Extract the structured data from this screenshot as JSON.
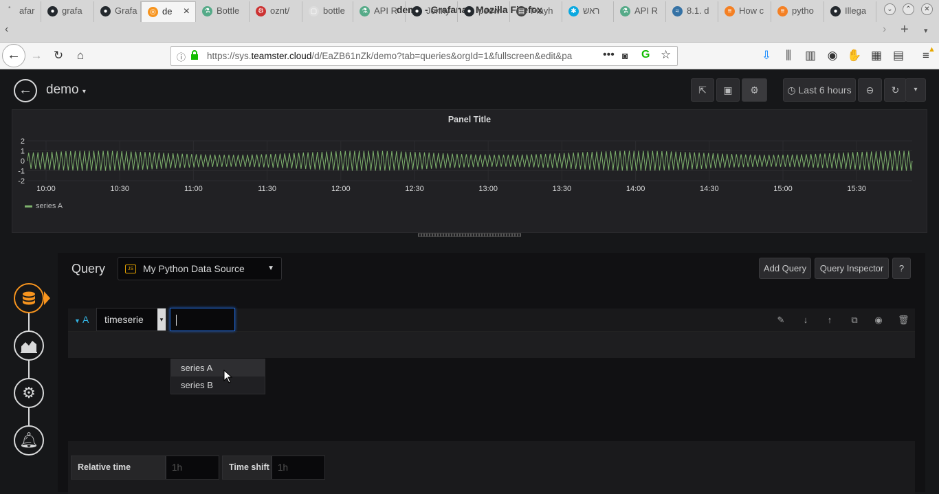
{
  "window": {
    "title": "demo - Grafana - Mozilla Firefox"
  },
  "tabs": [
    {
      "label": "afar",
      "icon": "grafana-icon"
    },
    {
      "label": "grafa",
      "icon": "github-icon"
    },
    {
      "label": "Grafa",
      "icon": "github-icon"
    },
    {
      "label": "de",
      "icon": "grafana-icon",
      "active": true
    },
    {
      "label": "Bottle",
      "icon": "flask-icon"
    },
    {
      "label": "oznt/",
      "icon": "gear-icon"
    },
    {
      "label": "bottle",
      "icon": "cube-icon"
    },
    {
      "label": "API R",
      "icon": "flask-icon"
    },
    {
      "label": "Jonny",
      "icon": "github-icon"
    },
    {
      "label": "peew",
      "icon": "github-icon"
    },
    {
      "label": "Playh",
      "icon": "book-icon"
    },
    {
      "label": "ראש",
      "icon": "hebrew-site-icon"
    },
    {
      "label": "API R",
      "icon": "flask-icon"
    },
    {
      "label": "8.1. d",
      "icon": "python-icon"
    },
    {
      "label": "How c",
      "icon": "stackoverflow-icon"
    },
    {
      "label": "pytho",
      "icon": "stackoverflow-icon"
    },
    {
      "label": "Illega",
      "icon": "github-icon"
    }
  ],
  "navbar": {
    "url_prefix": "https://sys.",
    "url_domain": "teamster.cloud",
    "url_rest": "/d/EaZB61nZk/demo?tab=queries&orgId=1&fullscreen&edit&pa"
  },
  "dashboard": {
    "title": "demo",
    "time_range_label": "Last 6 hours"
  },
  "panel": {
    "title": "Panel Title",
    "legend": "series A"
  },
  "chart_data": {
    "type": "line",
    "title": "Panel Title",
    "x_ticks": [
      "10:00",
      "10:30",
      "11:00",
      "11:30",
      "12:00",
      "12:30",
      "13:00",
      "13:30",
      "14:00",
      "14:30",
      "15:00",
      "15:30"
    ],
    "y_ticks": [
      "2",
      "1",
      "0",
      "-1",
      "-2"
    ],
    "ylim": [
      -2,
      2
    ],
    "series": [
      {
        "name": "series A",
        "color": "#7eb26d",
        "amplitude": 1,
        "shape": "dense sine oscillation"
      }
    ],
    "legend_position": "bottom-left"
  },
  "editor": {
    "query_label": "Query",
    "datasource": "My Python Data Source",
    "add_query": "Add Query",
    "query_inspector": "Query Inspector",
    "help": "?",
    "query_ref": "A",
    "type_select": "timeserie",
    "series_input": "",
    "dropdown_options": [
      "series A",
      "series B"
    ],
    "relative_time_label": "Relative time",
    "relative_time_placeholder": "1h",
    "time_shift_label": "Time shift",
    "time_shift_placeholder": "1h"
  }
}
